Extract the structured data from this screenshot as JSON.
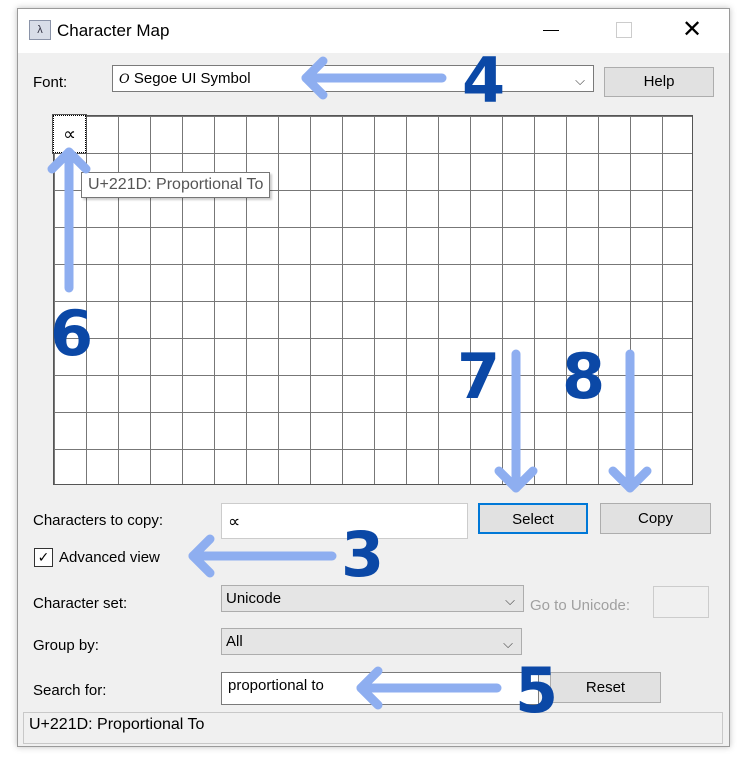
{
  "window": {
    "title": "Character Map",
    "app_icon": "charmap-icon",
    "controls": [
      "minimize-icon",
      "maximize-icon",
      "close-icon"
    ]
  },
  "font": {
    "label": "Font:",
    "value": "Segoe UI Symbol",
    "font_glyph": "O",
    "help_label": "Help"
  },
  "grid": {
    "selected_char": "∝",
    "columns": 20,
    "rows": 10,
    "tooltip": "U+221D: Proportional To"
  },
  "copy": {
    "label": "Characters to copy:",
    "value": "∝",
    "select_label": "Select",
    "copy_label": "Copy"
  },
  "advanced": {
    "label": "Advanced view",
    "checked": true
  },
  "charset": {
    "label": "Character set:",
    "value": "Unicode",
    "goto_label": "Go to Unicode:",
    "goto_value": ""
  },
  "group": {
    "label": "Group by:",
    "value": "All"
  },
  "search": {
    "label": "Search for:",
    "value": "proportional to",
    "reset_label": "Reset"
  },
  "status": {
    "text": "U+221D: Proportional To"
  },
  "annotations": {
    "n3": "3",
    "n4": "4",
    "n5": "5",
    "n6": "6",
    "n7": "7",
    "n8": "8",
    "arrow_color": "#8eaef0",
    "number_color": "#0b48a6"
  }
}
